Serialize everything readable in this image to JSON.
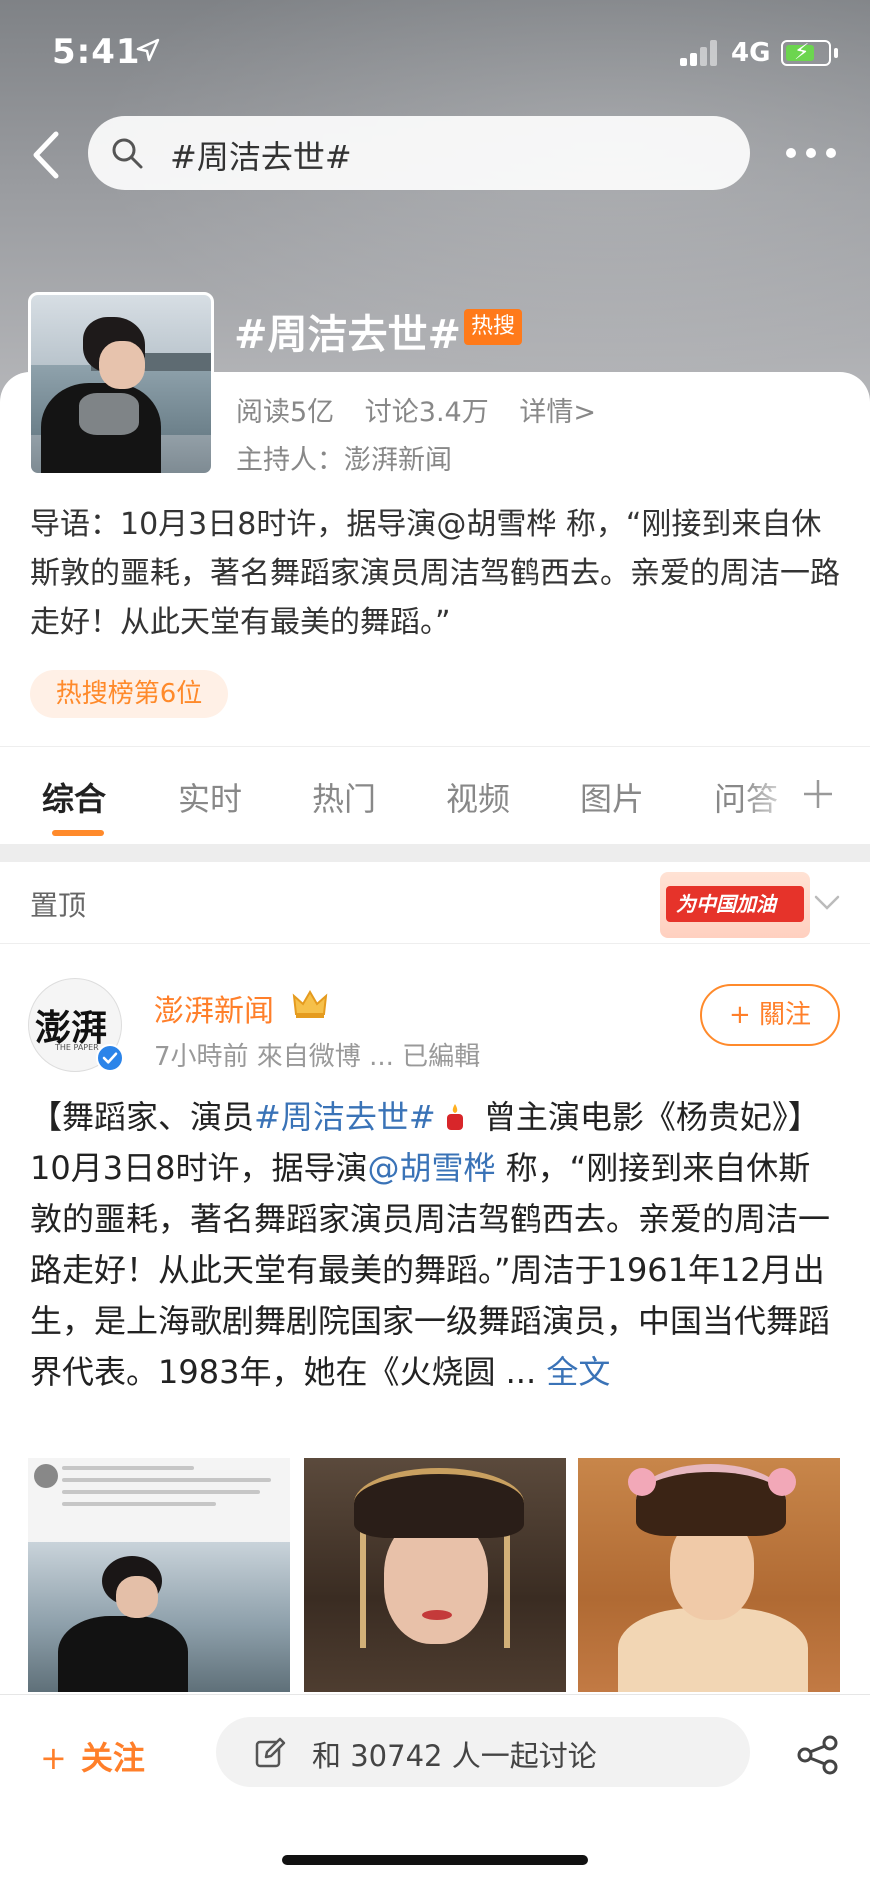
{
  "status_bar": {
    "time": "5:41",
    "network": "4G"
  },
  "search": {
    "query": "#周洁去世#"
  },
  "topic": {
    "title": "#周洁去世#",
    "hot_badge": "热搜",
    "stats": {
      "reads": "阅读5亿",
      "discussions": "讨论3.4万",
      "details": "详情>"
    },
    "host": "主持人：澎湃新闻",
    "intro": "导语：10月3日8时许，据导演@胡雪桦 称，“刚接到来自休斯敦的噩耗，著名舞蹈家演员周洁驾鹤西去。亲爱的周洁一路走好！从此天堂有最美的舞蹈。”",
    "rank_tag": "热搜榜第6位"
  },
  "tabs": [
    {
      "label": "综合",
      "active": true
    },
    {
      "label": "实时"
    },
    {
      "label": "热门"
    },
    {
      "label": "视频"
    },
    {
      "label": "图片"
    },
    {
      "label": "问答"
    }
  ],
  "pinned": {
    "label": "置顶",
    "banner_text": "为中国加油"
  },
  "post": {
    "avatar_text": "澎湃",
    "avatar_sub": "THE PAPER",
    "user": "澎湃新闻",
    "meta": "7小時前  來自微博 ...  已編輯",
    "follow_label": "+ 關注",
    "body_prefix": "【舞蹈家、演员",
    "body_tag": "#周洁去世#",
    "body_mid": " 曾主演电影《杨贵妃》】10月3日8时许，据导演",
    "body_mention": "@胡雪桦",
    "body_rest": " 称，“刚接到来自休斯敦的噩耗，著名舞蹈家演员周洁驾鹤西去。亲爱的周洁一路走好！从此天堂有最美的舞蹈。”周洁于1961年12月出生，是上海歌剧舞剧院国家一级舞蹈演员，中国当代舞蹈界代表。1983年，她在《火烧圆 ... ",
    "full_text_link": "全文"
  },
  "bottom_bar": {
    "follow_label": "关注",
    "discuss_placeholder": "和 30742 人一起讨论"
  },
  "colors": {
    "accent": "#ff7f2a",
    "link": "#3a73b7",
    "verified": "#2b84e9"
  }
}
